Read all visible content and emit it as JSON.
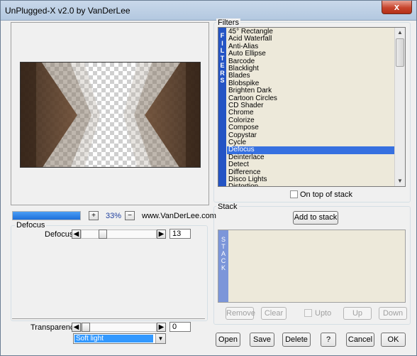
{
  "window": {
    "title": "UnPlugged-X v2.0 by VanDerLee",
    "close_label": "x"
  },
  "preview": {
    "zoom_label": "33%",
    "zoom_in_label": "+",
    "zoom_out_label": "−",
    "progress_fraction": 1.0,
    "website": "www.VanDerLee.com"
  },
  "filters": {
    "group_label": "Filters",
    "strip_label": "FILTERS",
    "items": [
      "45° Rectangle",
      "Acid Waterfall",
      "Anti-Alias",
      "Auto Ellipse",
      "Barcode",
      "Blacklight",
      "Blades",
      "Blobspike",
      "Brighten Dark",
      "Cartoon Circles",
      "CD Shader",
      "Chrome",
      "Colorize",
      "Compose",
      "Copystar",
      "Cycle",
      "Defocus",
      "Deinterlace",
      "Detect",
      "Difference",
      "Disco Lights",
      "Distortion"
    ],
    "selected": "Defocus",
    "on_top_label": "On top of stack"
  },
  "params": {
    "group_label": "Defocus",
    "defocus_label": "Defocus",
    "defocus_value": "13",
    "transparency_label": "Transparency",
    "transparency_value": "0",
    "blend_mode": "Soft light"
  },
  "stack": {
    "group_label": "Stack",
    "add_label": "Add to stack",
    "strip_label": "STACK",
    "remove_label": "Remove",
    "clear_label": "Clear",
    "upto_label": "Upto",
    "up_label": "Up",
    "down_label": "Down"
  },
  "footer": {
    "open_label": "Open",
    "save_label": "Save",
    "delete_label": "Delete",
    "help_label": "?",
    "cancel_label": "Cancel",
    "ok_label": "OK"
  },
  "colors": {
    "selection": "#3670e0",
    "list_background": "#ede9da",
    "strip_blue": "#2454c4",
    "close_red": "#c7452d"
  }
}
